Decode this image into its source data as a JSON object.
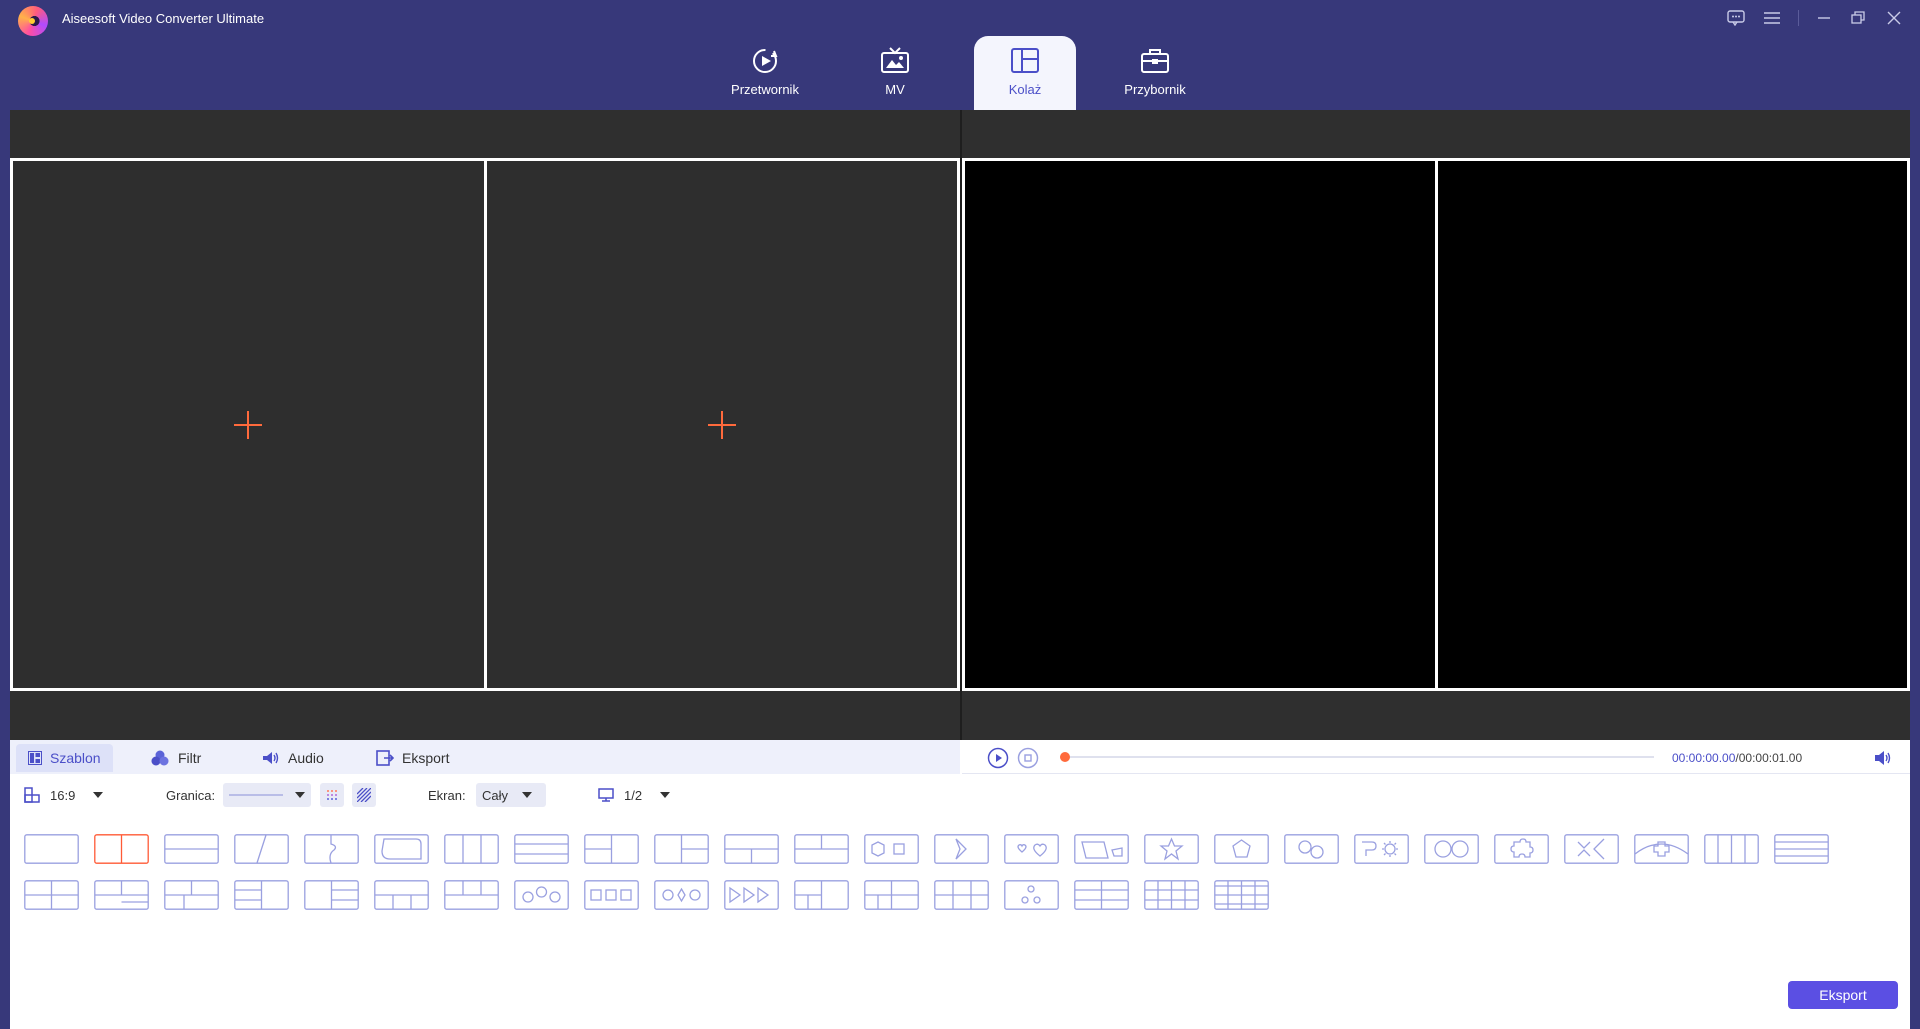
{
  "app": {
    "title": "Aiseesoft Video Converter Ultimate"
  },
  "window_buttons": [
    "chat-icon",
    "menu-icon",
    "minimize-icon",
    "restore-icon",
    "close-icon"
  ],
  "nav": {
    "tabs": [
      {
        "label": "Przetwornik",
        "icon": "converter-icon"
      },
      {
        "label": "MV",
        "icon": "mv-icon"
      },
      {
        "label": "Kolaż",
        "icon": "collage-icon",
        "active": true
      },
      {
        "label": "Przybornik",
        "icon": "toolbox-icon"
      }
    ]
  },
  "editor": {
    "cells": 2
  },
  "tools": {
    "tabs": [
      {
        "label": "Szablon",
        "icon": "template-icon",
        "active": true
      },
      {
        "label": "Filtr",
        "icon": "filter-icon"
      },
      {
        "label": "Audio",
        "icon": "audio-icon"
      },
      {
        "label": "Eksport",
        "icon": "export-icon"
      }
    ]
  },
  "playback": {
    "current_time": "00:00:00.00",
    "total_time": "/00:00:01.00",
    "progress": 0
  },
  "options": {
    "aspect_ratio": "16:9",
    "border_label": "Granica:",
    "screen_label": "Ekran:",
    "screen_value": "Cały",
    "pages": "1/2"
  },
  "templates": {
    "selected_index": 1,
    "row1": [
      "single",
      "two-vertical",
      "two-horizontal",
      "diagonal",
      "puzzle-vertical",
      "rounded-shape",
      "three-vertical",
      "three-horizontal",
      "one-top-two-bottom-left",
      "two-top-one-right",
      "one-top-two-bottom",
      "two-top-one-bottom",
      "hexagon-square",
      "arrow-shape",
      "hearts",
      "trapezoid",
      "star",
      "pentagon",
      "circles",
      "gear",
      "two-circles",
      "puzzle-piece",
      "cross-arrow",
      "plus-arc",
      "four-vertical",
      "four-horizontal"
    ],
    "row2": [
      "four-grid",
      "three-left-mix",
      "mixed-grid",
      "left-stack",
      "right-stack",
      "top-wide-three",
      "top-three-bottom",
      "three-hexagons",
      "three-squares",
      "circle-diamond",
      "triple-arrows",
      "five-grid",
      "six-grid",
      "grid-2x3",
      "dots-three",
      "grid-3x2",
      "grid-4x3",
      "film-grid"
    ]
  },
  "export": {
    "label": "Eksport"
  },
  "colors": {
    "accent": "#4b4fc8",
    "nav_bg": "#37387a",
    "plus": "#ff6a3c",
    "selected_template": "#ff5a36",
    "template_stroke": "#9aa0e0"
  }
}
